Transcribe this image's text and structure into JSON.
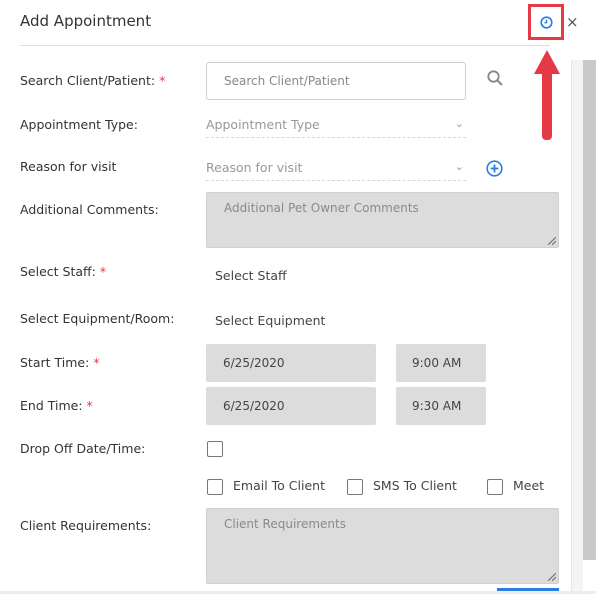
{
  "dialog": {
    "title": "Add Appointment"
  },
  "header": {
    "clock_icon": "clock-icon",
    "close_symbol": "×"
  },
  "form": {
    "search_client": {
      "label": "Search Client/Patient:",
      "required": "*",
      "placeholder": "Search Client/Patient"
    },
    "appointment_type": {
      "label": "Appointment Type:",
      "placeholder": "Appointment Type"
    },
    "reason": {
      "label": "Reason for visit",
      "placeholder": "Reason for visit"
    },
    "comments": {
      "label": "Additional Comments:",
      "placeholder": "Additional Pet Owner Comments"
    },
    "staff": {
      "label": "Select Staff:",
      "required": "*",
      "value": "Select Staff"
    },
    "equipment": {
      "label": "Select Equipment/Room:",
      "value": "Select Equipment"
    },
    "start_time": {
      "label": "Start Time:",
      "required": "*",
      "date": "6/25/2020",
      "time": "9:00 AM"
    },
    "end_time": {
      "label": "End Time:",
      "required": "*",
      "date": "6/25/2020",
      "time": "9:30 AM"
    },
    "drop_off": {
      "label": "Drop Off Date/Time:"
    },
    "notify": {
      "email": "Email To Client",
      "sms": "SMS To Client",
      "meet": "Meet"
    },
    "client_requirements": {
      "label": "Client Requirements:",
      "placeholder": "Client Requirements"
    }
  },
  "colors": {
    "accent": "#2a7de1",
    "highlight": "#e53946",
    "required": "#e53946"
  }
}
